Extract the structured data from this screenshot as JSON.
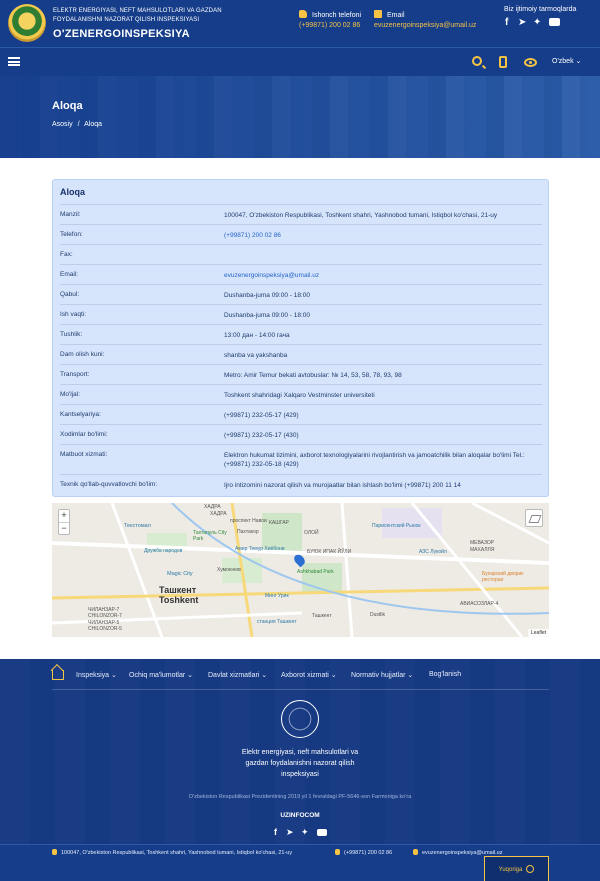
{
  "header": {
    "org_line1": "ELEKTR ENERGIYASI, NEFT MAHSULOTLARI VA GAZDAN",
    "org_line2": "FOYDALANISHNI NAZORAT QILISH INSPEKSIYASI",
    "org_name": "O'ZENERGOINSPEKSIYA",
    "phone_label": "Ishonch telefoni",
    "phone_value": "(+99871) 200 02 86",
    "email_label": "Email",
    "email_value": "evuzenergoinspeksiya@umail.uz",
    "social_title": "Biz ijtimoiy tarmoqlarda"
  },
  "navbar": {
    "lang": "O'zbek"
  },
  "hero": {
    "title": "Aloqa",
    "breadcrumb": [
      "Asosiy",
      "/",
      "Aloqa"
    ]
  },
  "card": {
    "title": "Aloqa",
    "rows": [
      {
        "key": "Manzil:",
        "value": "100047, O'zbekiston Respublikasi, Toshkent shahri, Yashnobod tumani, Istiqbol ko'chasi, 21-uy"
      },
      {
        "key": "Telefon:",
        "value": "(+99871) 200 02 86"
      },
      {
        "key": "Fax:",
        "value": ""
      },
      {
        "key": "Email:",
        "value": "evuzenergoinspeksiya@umail.uz"
      },
      {
        "key": "Qabul:",
        "value": "Dushanba-juma 09:00 - 18:00"
      },
      {
        "key": "Ish vaqti:",
        "value": "Dushanba-juma 09:00 - 18:00"
      },
      {
        "key": "Tushlik:",
        "value": "13:00 дан - 14:00 гача"
      },
      {
        "key": "Dam olish kuni:",
        "value": "shanba va yakshanba"
      },
      {
        "key": "Transport:",
        "value": "Metro: Amir Temur bekati avtobuslar: № 14, 53, 58, 78, 93, 98"
      },
      {
        "key": "Mo'ljal:",
        "value": "Toshkent shahridagi Xalqaro Vestminster universiteti"
      },
      {
        "key": "Kantselyariya:",
        "value": "(+99871) 232-05-17 (429)"
      },
      {
        "key": "Xodimlar bo'limi:",
        "value": "(+99871) 232-05-17 (430)"
      },
      {
        "key": "Matbuot xizmati:",
        "value": "Elektron hukumat tizimini, axborot texnologiyalarini rivojlantirish va jamoatchilik bilan aloqalar bo'limi Tel.: (+99871) 232-05-18 (429)"
      },
      {
        "key": "Texnik qo'llab-quvvatlovchi bo'lim:",
        "value": "Ijro intizomini nazorat qilish va murojaatlar bilan ishlash bo'limi (+99871) 200 11 14"
      }
    ]
  },
  "map": {
    "zoom_in": "+",
    "zoom_out": "−",
    "city_ru": "Ташкент",
    "city_uz": "Toshkent",
    "labels": [
      "ХАДРА",
      "ХАДРА",
      "проспект Навои",
      "Текстомал",
      "Тахтапуль City Park",
      "Пахтакор",
      "Дружба народов",
      "Амир Темур Хиёбони",
      "Magic City",
      "Хумоюнов",
      "Ashkhabad Park",
      "КАШГАР",
      "ОЛОЙ",
      "БУЮК ИПАК ЙЎЛИ",
      "Парисентский Рынок",
      "АЗС Лукойл",
      "МЕВАЗОР",
      "МАХАЛЛЯ",
      "Бухарский дворик ресторан",
      "ЧИЛАНЗАР-7",
      "CHILONZOR-7",
      "ЧИЛАНЗАР-5",
      "CHILONZOR-5",
      "Минг Урик",
      "станция Ташкент",
      "Ташкент",
      "АВИАСОЗЛАР-4",
      "Dustlik"
    ],
    "attribution": "Leaflet"
  },
  "footer": {
    "nav": [
      "Inspeksiya",
      "Ochiq ma'lumotlar",
      "Davlat xizmatlari",
      "Axborot xizmati",
      "Normativ hujjatlar",
      "Bog'lanish"
    ],
    "org_name": "Elektr energiyasi, neft mahsulotlari va gazdan foydalanishni nazorat qilish inspeksiyasi",
    "decree": "O'zbekiston Respublikasi Prezidentining 2019 yil 1 fevraldagi PF-5646-son Farmoniga ko'ra",
    "uzinfocom": "UZINFOCOM",
    "address": "100047, O'zbekiston Respublikasi, Toshkent shahri, Yashnobod tumani, Istiqbol ko'chasi, 21-uy",
    "phone": "(+99871) 200 02 86",
    "email": "evuzenergoinspeksiya@umail.uz",
    "up_label": "Yuqoriga"
  },
  "colors": {
    "primary": "#163d8a",
    "accent": "#f6c344",
    "card_bg": "#d6e5fb",
    "link": "#2563c9"
  }
}
